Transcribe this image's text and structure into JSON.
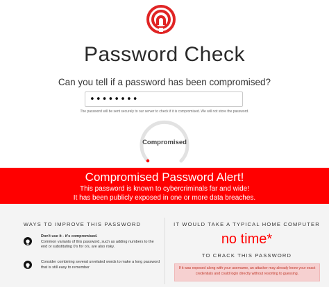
{
  "header": {
    "title": "Password Check",
    "subtitle": "Can you tell if a password has been compromised?"
  },
  "password_field": {
    "value": "••••••••",
    "note": "The password will be sent securely to our server to check if it is compromised. We will not store the password."
  },
  "gauge": {
    "label": "Compromised",
    "accent": "#ff0000"
  },
  "alert": {
    "title": "Compromised Password Alert!",
    "line1": "This password is known to cybercriminals far and wide!",
    "line2": "It has been publicly exposed in one or more data breaches.",
    "color": "#ff0000"
  },
  "improve": {
    "heading": "WAYS TO IMPROVE THIS PASSWORD",
    "tips": [
      {
        "icon": "lightbulb-icon",
        "bold": "Don't use it - it's compromised.",
        "text": "Common variants of this password, such as adding numbers to the end or substituting 0's for o's, are also risky."
      },
      {
        "icon": "lightbulb-icon",
        "bold": "",
        "text": "Consider combining several unrelated words to make a long password that is still easy to remember"
      }
    ]
  },
  "crack": {
    "heading": "IT WOULD TAKE A TYPICAL HOME COMPUTER",
    "time": "no time*",
    "subheading": "TO CRACK THIS PASSWORD",
    "warning": "If it was exposed along with your username, an attacker may already know your exact credentials and could login directly without resorting to guessing."
  }
}
